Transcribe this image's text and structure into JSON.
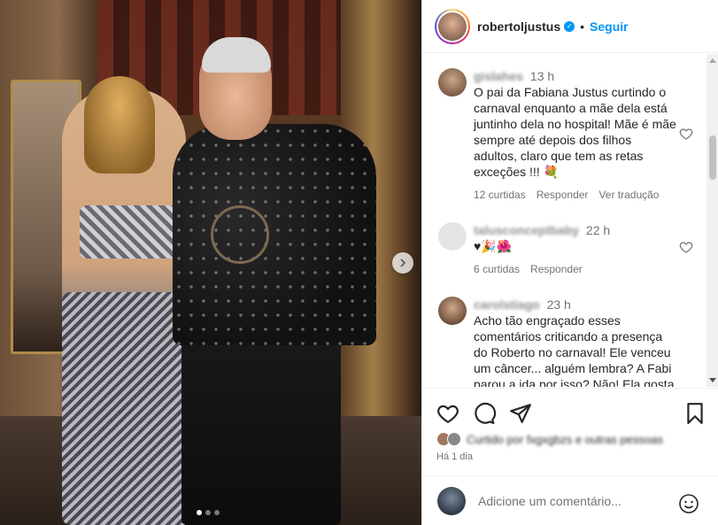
{
  "header": {
    "username": "robertoljustus",
    "separator": "•",
    "follow_label": "Seguir",
    "verified_icon": "verified-badge-icon"
  },
  "comments": [
    {
      "user": "gislahes",
      "time": "13 h",
      "text": "O pai da Fabiana Justus curtindo o carnaval enquanto a mãe dela está juntinho dela no hospital! Mãe é mãe sempre até depois dos filhos adultos, claro que tem as retas exceções !!! 💐",
      "likes": "12 curtidas",
      "reply": "Responder",
      "translate": "Ver tradução"
    },
    {
      "user": "talusconceptbaby",
      "time": "22 h",
      "text": "♥🎉🌺",
      "likes": "6 curtidas",
      "reply": "Responder"
    },
    {
      "user": "carolstiago",
      "time": "23 h",
      "text": "Acho tão engraçado esses comentários criticando a presença do Roberto no carnaval! Ele venceu um câncer... alguém lembra? A Fabi parou a ida por isso? Não! Ela gosta"
    }
  ],
  "likes_summary": "Curtido por fxgxgbzs e outras pessoas",
  "post_date": "Há 1 dia",
  "composer": {
    "placeholder": "Adicione um comentário..."
  },
  "icons": {
    "like": "heart-icon",
    "comment": "comment-icon",
    "share": "send-icon",
    "save": "bookmark-icon",
    "emoji": "emoji-icon",
    "next": "chevron-right-icon"
  },
  "colors": {
    "accent": "#0095f6",
    "text": "#262626",
    "muted": "#737373"
  },
  "carousel": {
    "total": 3,
    "active_index": 0
  }
}
